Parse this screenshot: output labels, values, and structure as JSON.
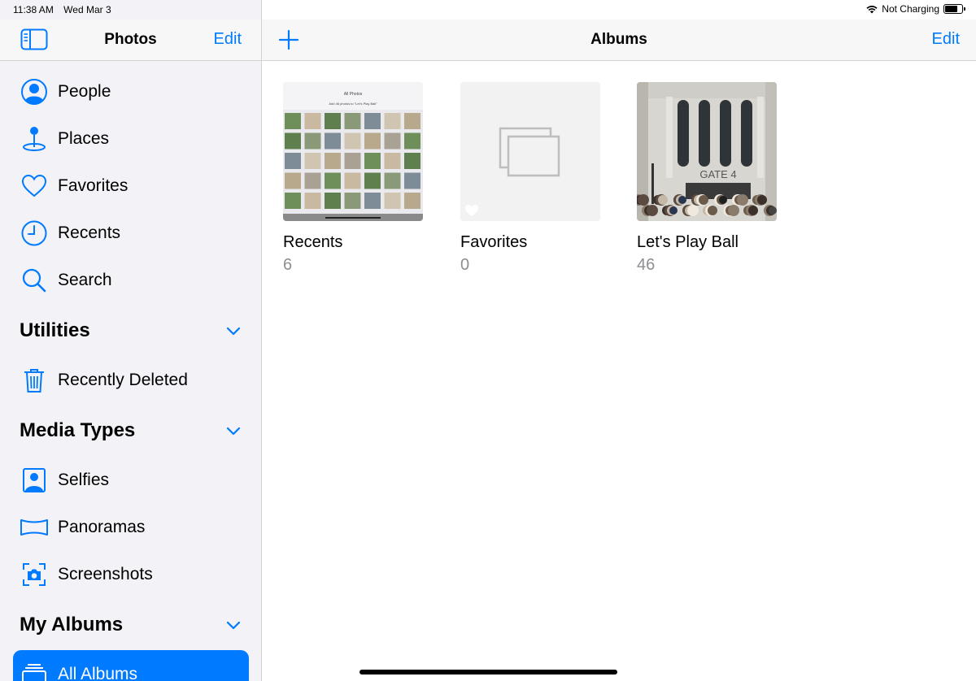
{
  "status": {
    "time": "11:38 AM",
    "date": "Wed Mar 3",
    "battery_text": "Not Charging",
    "battery_level": 0.75
  },
  "sidebar": {
    "title": "Photos",
    "edit_label": "Edit",
    "items": [
      {
        "label": "People",
        "icon": "person-circle-icon"
      },
      {
        "label": "Places",
        "icon": "map-pin-icon"
      },
      {
        "label": "Favorites",
        "icon": "heart-icon"
      },
      {
        "label": "Recents",
        "icon": "clock-icon"
      },
      {
        "label": "Search",
        "icon": "search-icon"
      }
    ],
    "sections": [
      {
        "title": "Utilities",
        "items": [
          {
            "label": "Recently Deleted",
            "icon": "trash-icon"
          }
        ]
      },
      {
        "title": "Media Types",
        "items": [
          {
            "label": "Selfies",
            "icon": "selfie-icon"
          },
          {
            "label": "Panoramas",
            "icon": "panorama-icon"
          },
          {
            "label": "Screenshots",
            "icon": "screenshot-icon"
          }
        ]
      },
      {
        "title": "My Albums",
        "items": [
          {
            "label": "All Albums",
            "icon": "albums-icon",
            "selected": true
          }
        ]
      }
    ]
  },
  "main": {
    "title": "Albums",
    "edit_label": "Edit",
    "albums": [
      {
        "name": "Recents",
        "count": "6"
      },
      {
        "name": "Favorites",
        "count": "0"
      },
      {
        "name": "Let's Play Ball",
        "count": "46"
      }
    ],
    "thumb_texts": {
      "recents_header": "All Photos",
      "recents_subtitle": "Add 46 photos to \"Let's Play Ball\"",
      "stadium_sign": "GATE 4"
    }
  },
  "colors": {
    "accent": "#007aff",
    "sidebar_bg": "#f2f2f7",
    "secondary_text": "#8e8e93"
  }
}
